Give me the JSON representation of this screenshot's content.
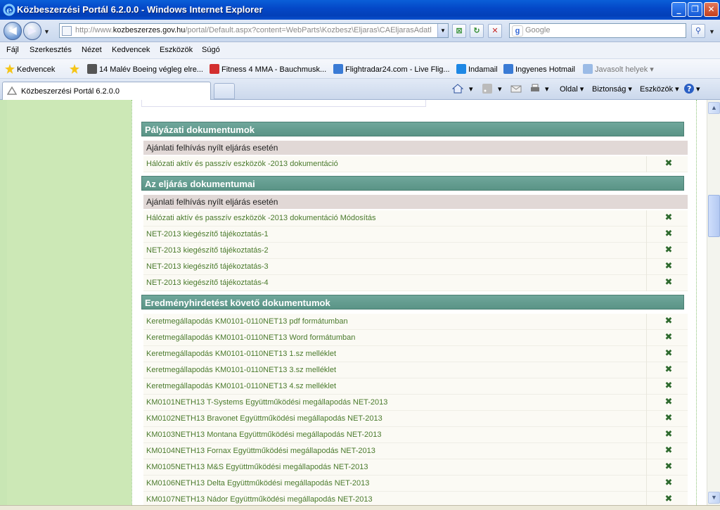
{
  "window": {
    "title": "Közbeszerzési Portál 6.2.0.0 - Windows Internet Explorer",
    "minimize": "_",
    "maximize": "❐",
    "close": "✕"
  },
  "address": {
    "url_prefix": "http://www.",
    "url_domain": "kozbeszerzes.gov.hu",
    "url_rest": "/portal/Default.aspx?content=WebParts\\Kozbesz\\Eljaras\\CAEljarasAdatl",
    "search_placeholder": "Google"
  },
  "menu": [
    "Fájl",
    "Szerkesztés",
    "Nézet",
    "Kedvencek",
    "Eszközök",
    "Súgó"
  ],
  "favorites": {
    "label": "Kedvencek",
    "items": [
      "14 Malév Boeing végleg elre...",
      "Fitness 4 MMA - Bauchmusk...",
      "Flightradar24.com - Live Flig...",
      "Indamail",
      "Ingyenes Hotmail",
      "Javasolt helyek"
    ]
  },
  "tab": {
    "label": "Közbeszerzési Portál 6.2.0.0"
  },
  "commands": {
    "page": "Oldal",
    "safety": "Biztonság",
    "tools": "Eszközök"
  },
  "sections": [
    {
      "title": "Pályázati dokumentumok",
      "subtitle": "Ajánlati felhívás nyílt eljárás esetén",
      "rows": [
        "Hálózati aktív és passzív eszközök -2013 dokumentáció"
      ]
    },
    {
      "title": "Az eljárás dokumentumai",
      "subtitle": "Ajánlati felhívás nyílt eljárás esetén",
      "rows": [
        "Hálózati aktív és passzív eszközök -2013 dokumentáció Módosítás",
        "NET-2013 kiegészítő tájékoztatás-1",
        "NET-2013 kiegészítő tájékoztatás-2",
        "NET-2013 kiegészítő tájékoztatás-3",
        "NET-2013 kiegészítő tájékoztatás-4"
      ]
    },
    {
      "title": "Eredményhirdetést követő dokumentumok",
      "rows": [
        "Keretmegállapodás KM0101-0110NET13 pdf formátumban",
        "Keretmegállapodás KM0101-0110NET13 Word formátumban",
        "Keretmegállapodás KM0101-0110NET13 1.sz melléklet",
        "Keretmegállapodás KM0101-0110NET13 3.sz melléklet",
        "Keretmegállapodás KM0101-0110NET13 4.sz melléklet",
        "KM0101NETH13 T-Systems Együttműködési megállapodás NET-2013",
        "KM0102NETH13 Bravonet Együttműködési megállapodás NET-2013",
        "KM0103NETH13 Montana Együttműködési megállapodás NET-2013",
        "KM0104NETH13 Fornax Együttműködési megállapodás NET-2013",
        "KM0105NETH13 M&S Együttműködési megállapodás NET-2013",
        "KM0106NETH13 Delta Együttműködési megállapodás NET-2013",
        "KM0107NETH13 Nádor Együttműködési megállapodás NET-2013"
      ]
    }
  ],
  "colors": {
    "section_header": "#5f998b",
    "link": "#4a7a2c",
    "left_panel": "#c8e6b4"
  }
}
